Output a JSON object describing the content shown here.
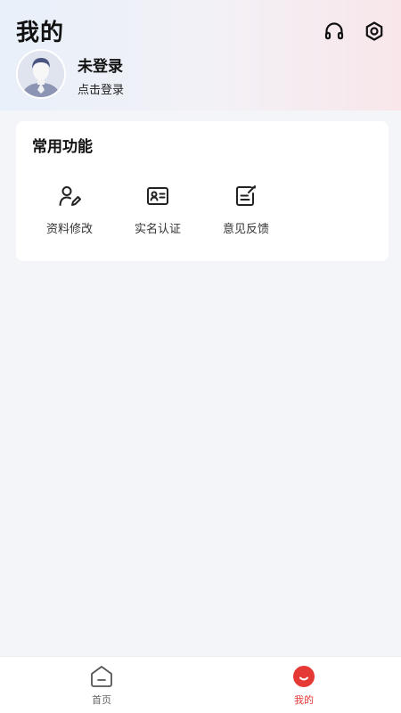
{
  "header": {
    "title": "我的",
    "user_name": "未登录",
    "login_prompt": "点击登录",
    "icons": [
      "headset-icon",
      "settings-gear-icon"
    ]
  },
  "common_functions": {
    "title": "常用功能",
    "items": [
      {
        "label": "资料修改",
        "icon": "edit-profile-icon"
      },
      {
        "label": "实名认证",
        "icon": "id-card-icon"
      },
      {
        "label": "意见反馈",
        "icon": "feedback-icon"
      }
    ]
  },
  "tabbar": {
    "items": [
      {
        "label": "首页",
        "icon": "home-icon",
        "active": false
      },
      {
        "label": "我的",
        "icon": "mine-icon",
        "active": true
      }
    ]
  },
  "colors": {
    "accent": "#e53935",
    "header_gradient": [
      "#e8f0fa",
      "#f8e6ea"
    ],
    "background": "#f3f5f8"
  }
}
